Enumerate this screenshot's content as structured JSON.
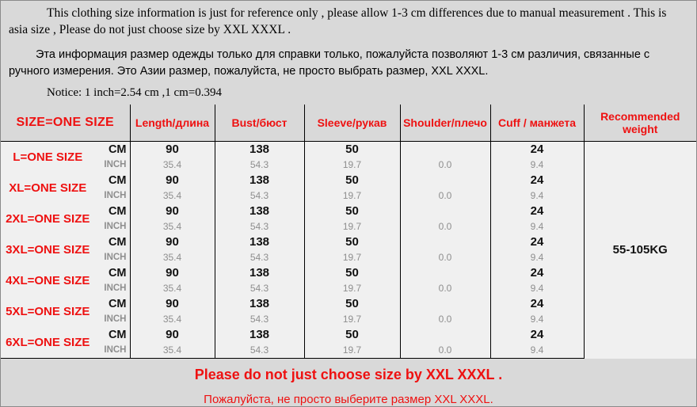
{
  "notes": {
    "english": "This clothing size information is just for reference only , please allow 1-3 cm differences due to manual measurement . This  is asia size , Please do not just choose size by XXL XXXL .",
    "russian": "Эта информация размер одежды только для справки только, пожалуйста позволяют 1-3 см  различия, связанные с ручного измерения. Это Азии размер, пожалуйста, не просто выбрать размер, XXL XXXL.",
    "notice": "Notice: 1 inch=2.54 cm ,1 cm=0.394"
  },
  "table": {
    "headers": [
      "SIZE=ONE SIZE",
      "Length/длина",
      "Bust/бюст",
      "Sleeve/рукав",
      "Shoulder/плечо",
      "Cuff / манжета",
      "Recommended weight"
    ],
    "unit_labels": {
      "cm": "CM",
      "inch": "INCH"
    },
    "recommended_weight": "55-105KG",
    "rows": [
      {
        "size": "L=ONE SIZE",
        "cm": {
          "length": "90",
          "bust": "138",
          "sleeve": "50",
          "shoulder": "",
          "cuff": "24"
        },
        "inch": {
          "length": "35.4",
          "bust": "54.3",
          "sleeve": "19.7",
          "shoulder": "0.0",
          "cuff": "9.4"
        }
      },
      {
        "size": "XL=ONE SIZE",
        "cm": {
          "length": "90",
          "bust": "138",
          "sleeve": "50",
          "shoulder": "",
          "cuff": "24"
        },
        "inch": {
          "length": "35.4",
          "bust": "54.3",
          "sleeve": "19.7",
          "shoulder": "0.0",
          "cuff": "9.4"
        }
      },
      {
        "size": "2XL=ONE SIZE",
        "cm": {
          "length": "90",
          "bust": "138",
          "sleeve": "50",
          "shoulder": "",
          "cuff": "24"
        },
        "inch": {
          "length": "35.4",
          "bust": "54.3",
          "sleeve": "19.7",
          "shoulder": "0.0",
          "cuff": "9.4"
        }
      },
      {
        "size": "3XL=ONE SIZE",
        "cm": {
          "length": "90",
          "bust": "138",
          "sleeve": "50",
          "shoulder": "",
          "cuff": "24"
        },
        "inch": {
          "length": "35.4",
          "bust": "54.3",
          "sleeve": "19.7",
          "shoulder": "0.0",
          "cuff": "9.4"
        }
      },
      {
        "size": "4XL=ONE SIZE",
        "cm": {
          "length": "90",
          "bust": "138",
          "sleeve": "50",
          "shoulder": "",
          "cuff": "24"
        },
        "inch": {
          "length": "35.4",
          "bust": "54.3",
          "sleeve": "19.7",
          "shoulder": "0.0",
          "cuff": "9.4"
        }
      },
      {
        "size": "5XL=ONE SIZE",
        "cm": {
          "length": "90",
          "bust": "138",
          "sleeve": "50",
          "shoulder": "",
          "cuff": "24"
        },
        "inch": {
          "length": "35.4",
          "bust": "54.3",
          "sleeve": "19.7",
          "shoulder": "0.0",
          "cuff": "9.4"
        }
      },
      {
        "size": "6XL=ONE SIZE",
        "cm": {
          "length": "90",
          "bust": "138",
          "sleeve": "50",
          "shoulder": "",
          "cuff": "24"
        },
        "inch": {
          "length": "35.4",
          "bust": "54.3",
          "sleeve": "19.7",
          "shoulder": "0.0",
          "cuff": "9.4"
        }
      }
    ]
  },
  "footer": {
    "english": "Please do not just choose size by XXL XXXL .",
    "russian": "Пожалуйста, не просто выберите размер XXL XXXL."
  },
  "colors": {
    "accent_red": "#ee1111",
    "page_background": "#d9d9d9",
    "table_background": "#f0f0f0",
    "inch_grey": "#8e8e8e"
  }
}
